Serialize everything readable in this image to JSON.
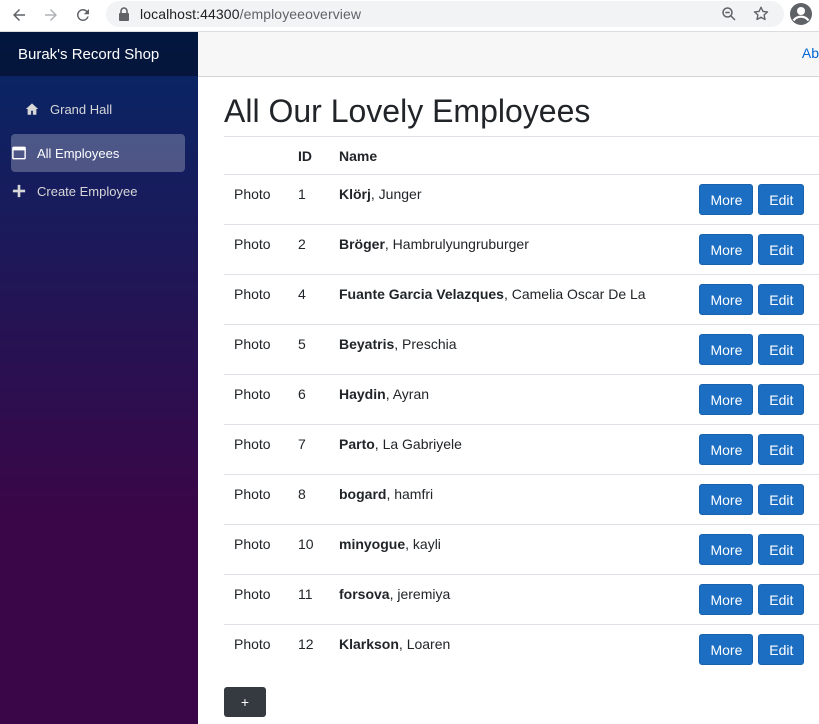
{
  "browser": {
    "url_host": "localhost:44300",
    "url_path": "/employeeoverview"
  },
  "sidebar": {
    "brand": "Burak's Record Shop",
    "items": [
      {
        "label": "Grand Hall",
        "icon": "home-icon"
      },
      {
        "label": "All Employees",
        "icon": "browser-window-icon",
        "active": true
      },
      {
        "label": "Create Employee",
        "icon": "plus-icon"
      }
    ]
  },
  "toprow": {
    "about": "Ab"
  },
  "page": {
    "title": "All Our Lovely Employees",
    "columns": [
      "",
      "ID",
      "Name",
      ""
    ],
    "more_label": "More",
    "edit_label": "Edit",
    "add_label": "+"
  },
  "employees": [
    {
      "photo": "Photo",
      "id": "1",
      "last": "Klörj",
      "first": ", Junger"
    },
    {
      "photo": "Photo",
      "id": "2",
      "last": "Bröger",
      "first": ", Hambrulyungruburger"
    },
    {
      "photo": "Photo",
      "id": "4",
      "last": "Fuante Garcia Velazques",
      "first": ", Camelia Oscar De La"
    },
    {
      "photo": "Photo",
      "id": "5",
      "last": "Beyatris",
      "first": ", Preschia"
    },
    {
      "photo": "Photo",
      "id": "6",
      "last": "Haydin",
      "first": ", Ayran"
    },
    {
      "photo": "Photo",
      "id": "7",
      "last": "Parto",
      "first": ", La Gabriyele"
    },
    {
      "photo": "Photo",
      "id": "8",
      "last": "bogard",
      "first": ", hamfri"
    },
    {
      "photo": "Photo",
      "id": "10",
      "last": "minyogue",
      "first": ", kayli"
    },
    {
      "photo": "Photo",
      "id": "11",
      "last": "forsova",
      "first": ", jeremiya"
    },
    {
      "photo": "Photo",
      "id": "12",
      "last": "Klarkson",
      "first": ", Loaren"
    }
  ],
  "colors": {
    "primary": "#1b6ec2",
    "sidebar_top": "#052767",
    "sidebar_bottom": "#3a0647",
    "dark_button": "#343a40"
  }
}
